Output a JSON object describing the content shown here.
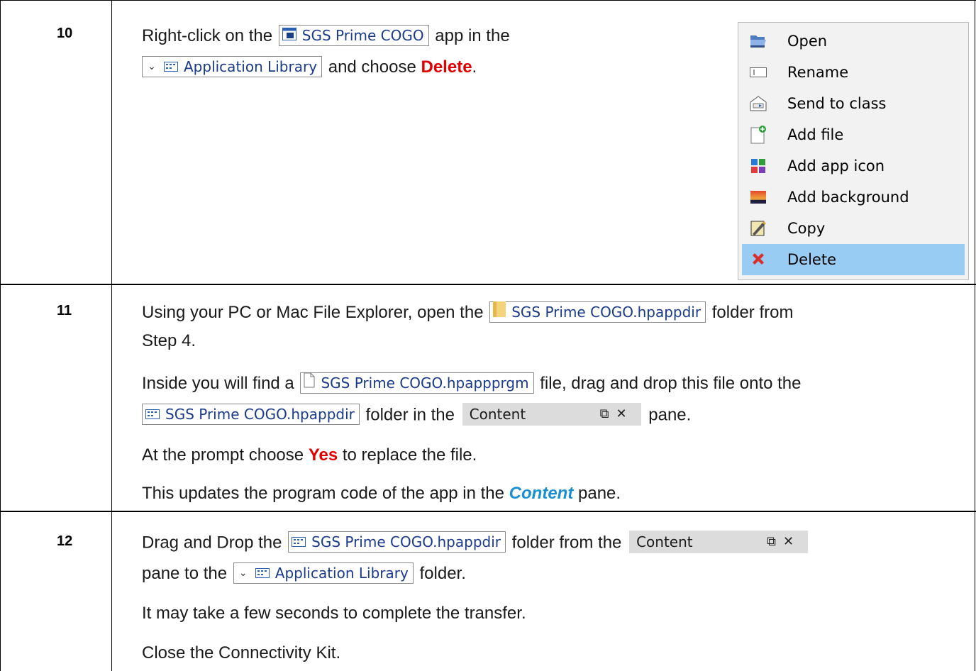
{
  "steps": [
    {
      "number": "10",
      "text": {
        "rightclick": "Right-click on the",
        "app_chip": "SGS Prime COGO",
        "app_in_the": "app in the",
        "library_chip": "Application Library",
        "and_choose": "and choose",
        "delete": "Delete",
        "period": "."
      },
      "context_menu": [
        {
          "label": "Open",
          "icon": "open-icon"
        },
        {
          "label": "Rename",
          "icon": "rename-icon"
        },
        {
          "label": "Send to class",
          "icon": "send-to-class-icon"
        },
        {
          "label": "Add file",
          "icon": "add-file-icon"
        },
        {
          "label": "Add app icon",
          "icon": "add-app-icon-icon"
        },
        {
          "label": "Add background",
          "icon": "add-background-icon"
        },
        {
          "label": "Copy",
          "icon": "copy-icon"
        },
        {
          "label": "Delete",
          "icon": "delete-icon",
          "selected": true
        }
      ]
    },
    {
      "number": "11",
      "text": {
        "using": "Using your PC or Mac File Explorer, open the",
        "folder_chip": "SGS Prime COGO.hpappdir",
        "folder_from": "folder from",
        "step4": "Step 4.",
        "inside": "Inside you will find a",
        "file_chip": "SGS Prime COGO.hpappprgm",
        "file_drag": "file, drag and drop this file onto the",
        "dir_chip": "SGS Prime COGO.hpappdir",
        "folder_in_the": "folder in the",
        "pane_label": "Content",
        "pane_word": "pane.",
        "prompt": "At the prompt choose",
        "yes": "Yes",
        "replace": "to replace the file.",
        "updates": "This updates the program code of the app in the",
        "content": "Content",
        "pane_end": "pane."
      }
    },
    {
      "number": "12",
      "text": {
        "drag": "Drag and Drop the",
        "dir_chip": "SGS Prime COGO.hpappdir",
        "folder_from_the": "folder from the",
        "pane_label": "Content",
        "pane_to_the": "pane to the",
        "library_chip": "Application Library",
        "folder": "folder.",
        "seconds": "It may take a few seconds to complete the transfer.",
        "close": "Close the Connectivity Kit."
      }
    }
  ],
  "colors": {
    "highlight": "#e00000",
    "emphasis": "#1a8fd6",
    "menu_selected": "#99ccf2"
  }
}
